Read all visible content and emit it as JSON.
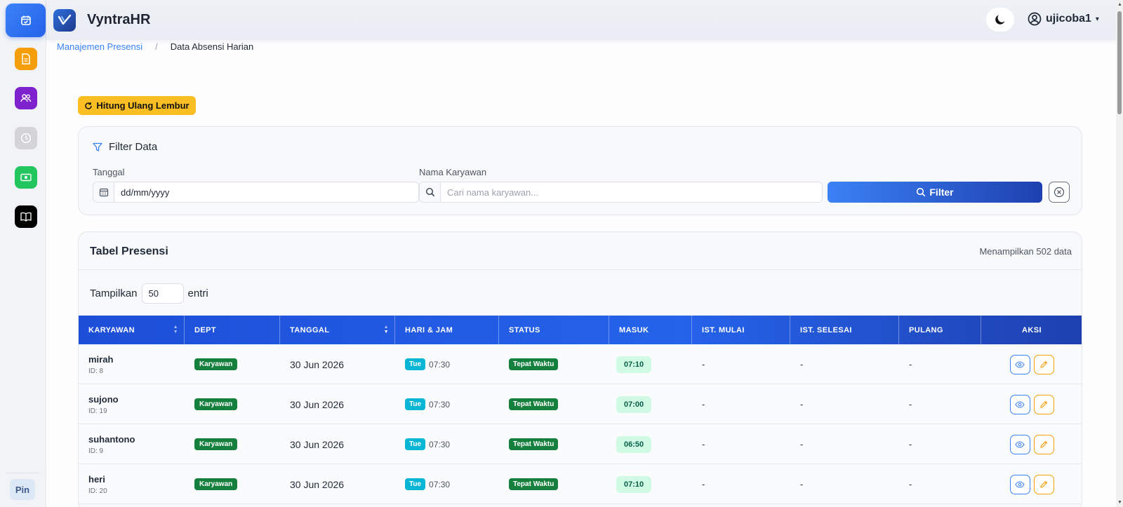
{
  "app": {
    "brand": "VyntraHR"
  },
  "sidebar": {
    "items": [
      {
        "name": "presensi",
        "icon": "calendar-check-icon",
        "color": "#2563eb",
        "active": true
      },
      {
        "name": "dokumen",
        "icon": "document-icon",
        "color": "#f59e0b"
      },
      {
        "name": "karyawan",
        "icon": "users-icon",
        "color": "#7e22ce"
      },
      {
        "name": "riwayat",
        "icon": "clock-icon",
        "color": "#d4d4d8"
      },
      {
        "name": "keuangan",
        "icon": "money-icon",
        "color": "#22c55e"
      },
      {
        "name": "panduan",
        "icon": "book-icon",
        "color": "#000000"
      }
    ],
    "pin_label": "Pin"
  },
  "header": {
    "theme_icon": "moon-icon",
    "user": {
      "icon": "user-circle-icon",
      "name": "ujicoba1"
    }
  },
  "breadcrumb": {
    "parent": "Manajemen Presensi",
    "separator": "/",
    "current": "Data Absensi Harian"
  },
  "actions": {
    "recalc_label": "Hitung Ulang Lembur",
    "recalc_color": "#fbbf24"
  },
  "filter": {
    "title": "Filter Data",
    "date_label": "Tanggal",
    "date_value": "dd/mm/yyyy",
    "name_label": "Nama Karyawan",
    "name_placeholder": "Cari nama karyawan...",
    "submit_label": "Filter"
  },
  "table": {
    "title": "Tabel Presensi",
    "count_text": "Menampilkan 502 data",
    "entries_prefix": "Tampilkan",
    "entries_value": "50",
    "entries_suffix": "entri",
    "columns": [
      "KARYAWAN",
      "DEPT",
      "TANGGAL",
      "HARI & JAM",
      "STATUS",
      "MASUK",
      "IST. MULAI",
      "IST. SELESAI",
      "PULANG",
      "AKSI"
    ],
    "rows": [
      {
        "name": "mirah",
        "id": "ID: 8",
        "dept": "Karyawan",
        "date": "30 Jun 2026",
        "day": "Tue",
        "schedule": "07:30",
        "status": "Tepat Waktu",
        "in": "07:10",
        "break_start": "-",
        "break_end": "-",
        "out": "-"
      },
      {
        "name": "sujono",
        "id": "ID: 19",
        "dept": "Karyawan",
        "date": "30 Jun 2026",
        "day": "Tue",
        "schedule": "07:30",
        "status": "Tepat Waktu",
        "in": "07:00",
        "break_start": "-",
        "break_end": "-",
        "out": "-"
      },
      {
        "name": "suhantono",
        "id": "ID: 9",
        "dept": "Karyawan",
        "date": "30 Jun 2026",
        "day": "Tue",
        "schedule": "07:30",
        "status": "Tepat Waktu",
        "in": "06:50",
        "break_start": "-",
        "break_end": "-",
        "out": "-"
      },
      {
        "name": "heri",
        "id": "ID: 20",
        "dept": "Karyawan",
        "date": "30 Jun 2026",
        "day": "Tue",
        "schedule": "07:30",
        "status": "Tepat Waktu",
        "in": "07:10",
        "break_start": "-",
        "break_end": "-",
        "out": "-"
      }
    ]
  }
}
